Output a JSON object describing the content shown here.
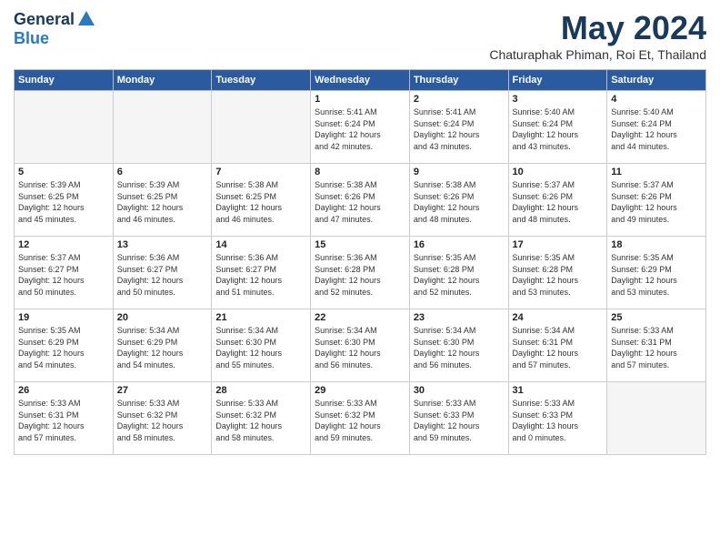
{
  "header": {
    "logo_general": "General",
    "logo_blue": "Blue",
    "month_title": "May 2024",
    "subtitle": "Chaturaphak Phiman, Roi Et, Thailand"
  },
  "days_of_week": [
    "Sunday",
    "Monday",
    "Tuesday",
    "Wednesday",
    "Thursday",
    "Friday",
    "Saturday"
  ],
  "weeks": [
    [
      {
        "day": "",
        "content": ""
      },
      {
        "day": "",
        "content": ""
      },
      {
        "day": "",
        "content": ""
      },
      {
        "day": "1",
        "content": "Sunrise: 5:41 AM\nSunset: 6:24 PM\nDaylight: 12 hours\nand 42 minutes."
      },
      {
        "day": "2",
        "content": "Sunrise: 5:41 AM\nSunset: 6:24 PM\nDaylight: 12 hours\nand 43 minutes."
      },
      {
        "day": "3",
        "content": "Sunrise: 5:40 AM\nSunset: 6:24 PM\nDaylight: 12 hours\nand 43 minutes."
      },
      {
        "day": "4",
        "content": "Sunrise: 5:40 AM\nSunset: 6:24 PM\nDaylight: 12 hours\nand 44 minutes."
      }
    ],
    [
      {
        "day": "5",
        "content": "Sunrise: 5:39 AM\nSunset: 6:25 PM\nDaylight: 12 hours\nand 45 minutes."
      },
      {
        "day": "6",
        "content": "Sunrise: 5:39 AM\nSunset: 6:25 PM\nDaylight: 12 hours\nand 46 minutes."
      },
      {
        "day": "7",
        "content": "Sunrise: 5:38 AM\nSunset: 6:25 PM\nDaylight: 12 hours\nand 46 minutes."
      },
      {
        "day": "8",
        "content": "Sunrise: 5:38 AM\nSunset: 6:26 PM\nDaylight: 12 hours\nand 47 minutes."
      },
      {
        "day": "9",
        "content": "Sunrise: 5:38 AM\nSunset: 6:26 PM\nDaylight: 12 hours\nand 48 minutes."
      },
      {
        "day": "10",
        "content": "Sunrise: 5:37 AM\nSunset: 6:26 PM\nDaylight: 12 hours\nand 48 minutes."
      },
      {
        "day": "11",
        "content": "Sunrise: 5:37 AM\nSunset: 6:26 PM\nDaylight: 12 hours\nand 49 minutes."
      }
    ],
    [
      {
        "day": "12",
        "content": "Sunrise: 5:37 AM\nSunset: 6:27 PM\nDaylight: 12 hours\nand 50 minutes."
      },
      {
        "day": "13",
        "content": "Sunrise: 5:36 AM\nSunset: 6:27 PM\nDaylight: 12 hours\nand 50 minutes."
      },
      {
        "day": "14",
        "content": "Sunrise: 5:36 AM\nSunset: 6:27 PM\nDaylight: 12 hours\nand 51 minutes."
      },
      {
        "day": "15",
        "content": "Sunrise: 5:36 AM\nSunset: 6:28 PM\nDaylight: 12 hours\nand 52 minutes."
      },
      {
        "day": "16",
        "content": "Sunrise: 5:35 AM\nSunset: 6:28 PM\nDaylight: 12 hours\nand 52 minutes."
      },
      {
        "day": "17",
        "content": "Sunrise: 5:35 AM\nSunset: 6:28 PM\nDaylight: 12 hours\nand 53 minutes."
      },
      {
        "day": "18",
        "content": "Sunrise: 5:35 AM\nSunset: 6:29 PM\nDaylight: 12 hours\nand 53 minutes."
      }
    ],
    [
      {
        "day": "19",
        "content": "Sunrise: 5:35 AM\nSunset: 6:29 PM\nDaylight: 12 hours\nand 54 minutes."
      },
      {
        "day": "20",
        "content": "Sunrise: 5:34 AM\nSunset: 6:29 PM\nDaylight: 12 hours\nand 54 minutes."
      },
      {
        "day": "21",
        "content": "Sunrise: 5:34 AM\nSunset: 6:30 PM\nDaylight: 12 hours\nand 55 minutes."
      },
      {
        "day": "22",
        "content": "Sunrise: 5:34 AM\nSunset: 6:30 PM\nDaylight: 12 hours\nand 56 minutes."
      },
      {
        "day": "23",
        "content": "Sunrise: 5:34 AM\nSunset: 6:30 PM\nDaylight: 12 hours\nand 56 minutes."
      },
      {
        "day": "24",
        "content": "Sunrise: 5:34 AM\nSunset: 6:31 PM\nDaylight: 12 hours\nand 57 minutes."
      },
      {
        "day": "25",
        "content": "Sunrise: 5:33 AM\nSunset: 6:31 PM\nDaylight: 12 hours\nand 57 minutes."
      }
    ],
    [
      {
        "day": "26",
        "content": "Sunrise: 5:33 AM\nSunset: 6:31 PM\nDaylight: 12 hours\nand 57 minutes."
      },
      {
        "day": "27",
        "content": "Sunrise: 5:33 AM\nSunset: 6:32 PM\nDaylight: 12 hours\nand 58 minutes."
      },
      {
        "day": "28",
        "content": "Sunrise: 5:33 AM\nSunset: 6:32 PM\nDaylight: 12 hours\nand 58 minutes."
      },
      {
        "day": "29",
        "content": "Sunrise: 5:33 AM\nSunset: 6:32 PM\nDaylight: 12 hours\nand 59 minutes."
      },
      {
        "day": "30",
        "content": "Sunrise: 5:33 AM\nSunset: 6:33 PM\nDaylight: 12 hours\nand 59 minutes."
      },
      {
        "day": "31",
        "content": "Sunrise: 5:33 AM\nSunset: 6:33 PM\nDaylight: 13 hours\nand 0 minutes."
      },
      {
        "day": "",
        "content": ""
      }
    ]
  ]
}
